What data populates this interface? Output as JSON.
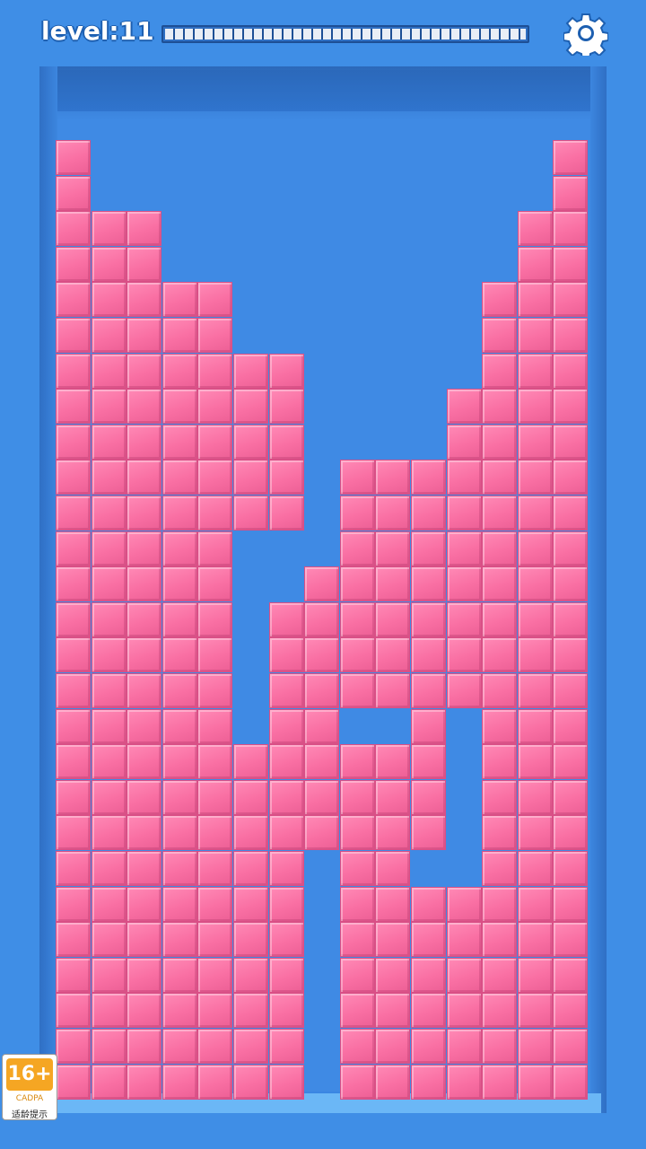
{
  "hud": {
    "level_label": "level:11",
    "progress_fraction": 0.0,
    "progress_segments": 40,
    "settings_icon": "gear-icon"
  },
  "colors": {
    "background": "#3f8ee6",
    "block": "#f96fa3",
    "block_edge": "#d94f86",
    "progress_border": "#1d4f95"
  },
  "board": {
    "cols": 15,
    "rows": 27,
    "columns": [
      {
        "top_row": 0,
        "gaps": []
      },
      {
        "top_row": 2,
        "gaps": []
      },
      {
        "top_row": 2,
        "gaps": []
      },
      {
        "top_row": 4,
        "gaps": []
      },
      {
        "top_row": 4,
        "gaps": []
      },
      {
        "top_row": 6,
        "gaps": [
          [
            11,
            16
          ]
        ]
      },
      {
        "top_row": 6,
        "gaps": [
          [
            11,
            12
          ]
        ]
      },
      {
        "top_row": 12,
        "gaps": [
          [
            20,
            26
          ]
        ]
      },
      {
        "top_row": 9,
        "gaps": [
          [
            16,
            16
          ]
        ]
      },
      {
        "top_row": 9,
        "gaps": [
          [
            16,
            16
          ]
        ]
      },
      {
        "top_row": 9,
        "gaps": [
          [
            20,
            20
          ]
        ]
      },
      {
        "top_row": 7,
        "gaps": [
          [
            16,
            20
          ]
        ]
      },
      {
        "top_row": 4,
        "gaps": []
      },
      {
        "top_row": 2,
        "gaps": []
      },
      {
        "top_row": 0,
        "gaps": []
      }
    ]
  },
  "age_badge": {
    "age": "16+",
    "org": "CADPA",
    "text": "适龄提示"
  }
}
